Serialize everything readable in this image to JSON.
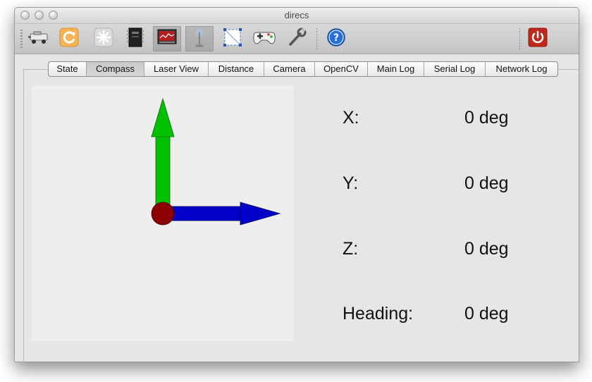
{
  "window": {
    "title": "direcs"
  },
  "toolbar": {
    "buttons": [
      {
        "icon": "robot-icon",
        "pressed": false
      },
      {
        "icon": "reset-icon",
        "pressed": false
      },
      {
        "icon": "simulation-icon",
        "pressed": false
      },
      {
        "icon": "chip-icon",
        "pressed": false
      },
      {
        "icon": "monitor-icon",
        "pressed": true
      },
      {
        "icon": "joystick-stick-icon",
        "pressed": true
      },
      {
        "icon": "selection-icon",
        "pressed": false
      },
      {
        "icon": "gamepad-icon",
        "pressed": false
      },
      {
        "icon": "wrench-icon",
        "pressed": false
      },
      {
        "icon": "help-icon",
        "pressed": false
      },
      {
        "icon": "power-icon",
        "pressed": false
      }
    ]
  },
  "tabs": [
    {
      "label": "State",
      "active": false
    },
    {
      "label": "Compass",
      "active": true
    },
    {
      "label": "Laser View",
      "active": false
    },
    {
      "label": "Distance",
      "active": false
    },
    {
      "label": "Camera",
      "active": false
    },
    {
      "label": "OpenCV",
      "active": false
    },
    {
      "label": "Main Log",
      "active": false
    },
    {
      "label": "Serial Log",
      "active": false
    },
    {
      "label": "Network Log",
      "active": false
    }
  ],
  "compass": {
    "x_label": "X:",
    "x_value": "0 deg",
    "y_label": "Y:",
    "y_value": "0 deg",
    "z_label": "Z:",
    "z_value": "0 deg",
    "heading_label": "Heading:",
    "heading_value": "0 deg"
  },
  "colors": {
    "y_axis": "#00c000",
    "x_axis": "#0000c8",
    "origin": "#8b0000",
    "power_button": "#c0281c",
    "help_button": "#2a6fd6"
  }
}
